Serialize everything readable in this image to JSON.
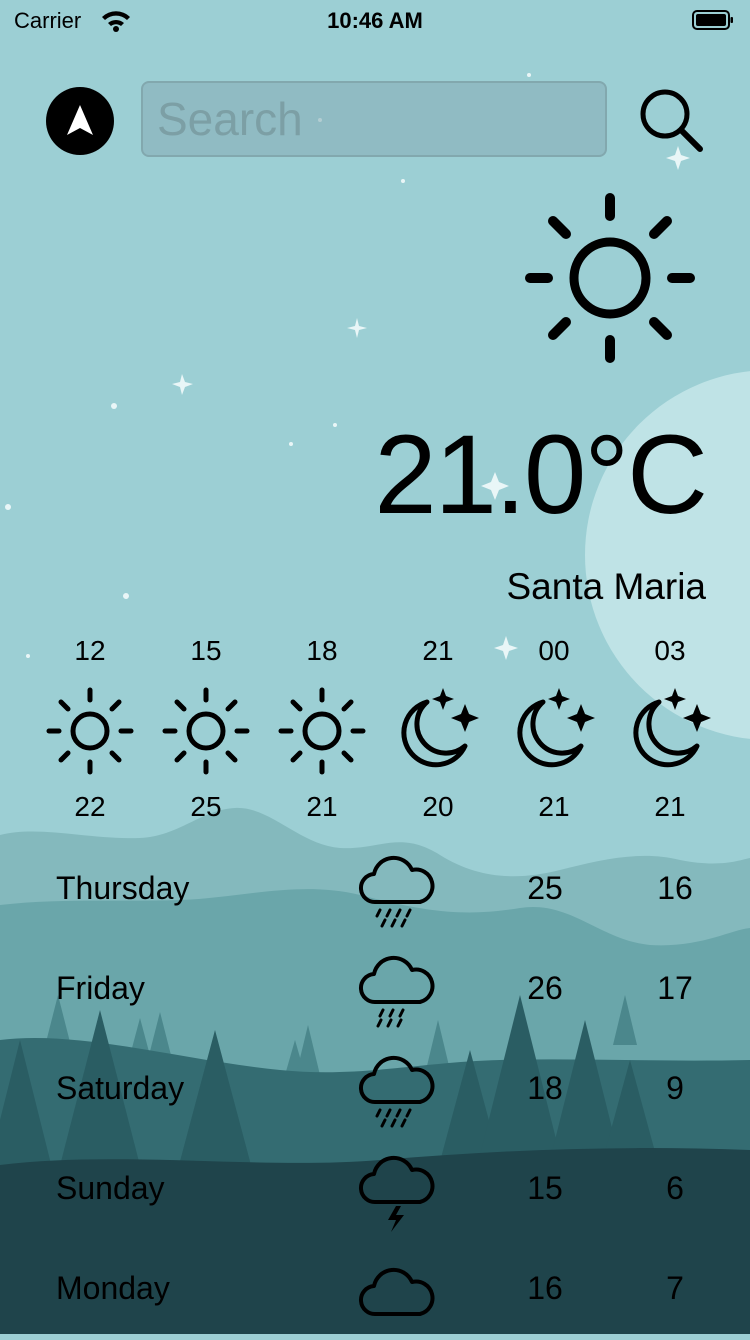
{
  "status_bar": {
    "carrier": "Carrier",
    "time": "10:46 AM"
  },
  "search": {
    "placeholder": "Search"
  },
  "current": {
    "temperature": "21.0°C",
    "city": "Santa Maria",
    "icon": "sun-icon"
  },
  "hourly": [
    {
      "time": "12",
      "temp": "22",
      "icon": "sun-icon"
    },
    {
      "time": "15",
      "temp": "25",
      "icon": "sun-icon"
    },
    {
      "time": "18",
      "temp": "21",
      "icon": "sun-icon"
    },
    {
      "time": "21",
      "temp": "20",
      "icon": "moon-stars-icon"
    },
    {
      "time": "00",
      "temp": "21",
      "icon": "moon-stars-icon"
    },
    {
      "time": "03",
      "temp": "21",
      "icon": "moon-stars-icon"
    }
  ],
  "daily": [
    {
      "day": "Thursday",
      "max": "25",
      "min": "16",
      "icon": "cloud-rain-icon"
    },
    {
      "day": "Friday",
      "max": "26",
      "min": "17",
      "icon": "cloud-rain-icon"
    },
    {
      "day": "Saturday",
      "max": "18",
      "min": "9",
      "icon": "cloud-rain-icon"
    },
    {
      "day": "Sunday",
      "max": "15",
      "min": "6",
      "icon": "cloud-bolt-icon"
    },
    {
      "day": "Monday",
      "max": "16",
      "min": "7",
      "icon": "cloud-icon"
    }
  ],
  "colors": {
    "sky": "#9ccfd4",
    "moon": "#bfe3e6",
    "hills_far": "#84b9bd",
    "hills_mid": "#6aa6aa",
    "trees_far": "#4b878c",
    "hills_near": "#346c72",
    "ground": "#1f444b"
  }
}
